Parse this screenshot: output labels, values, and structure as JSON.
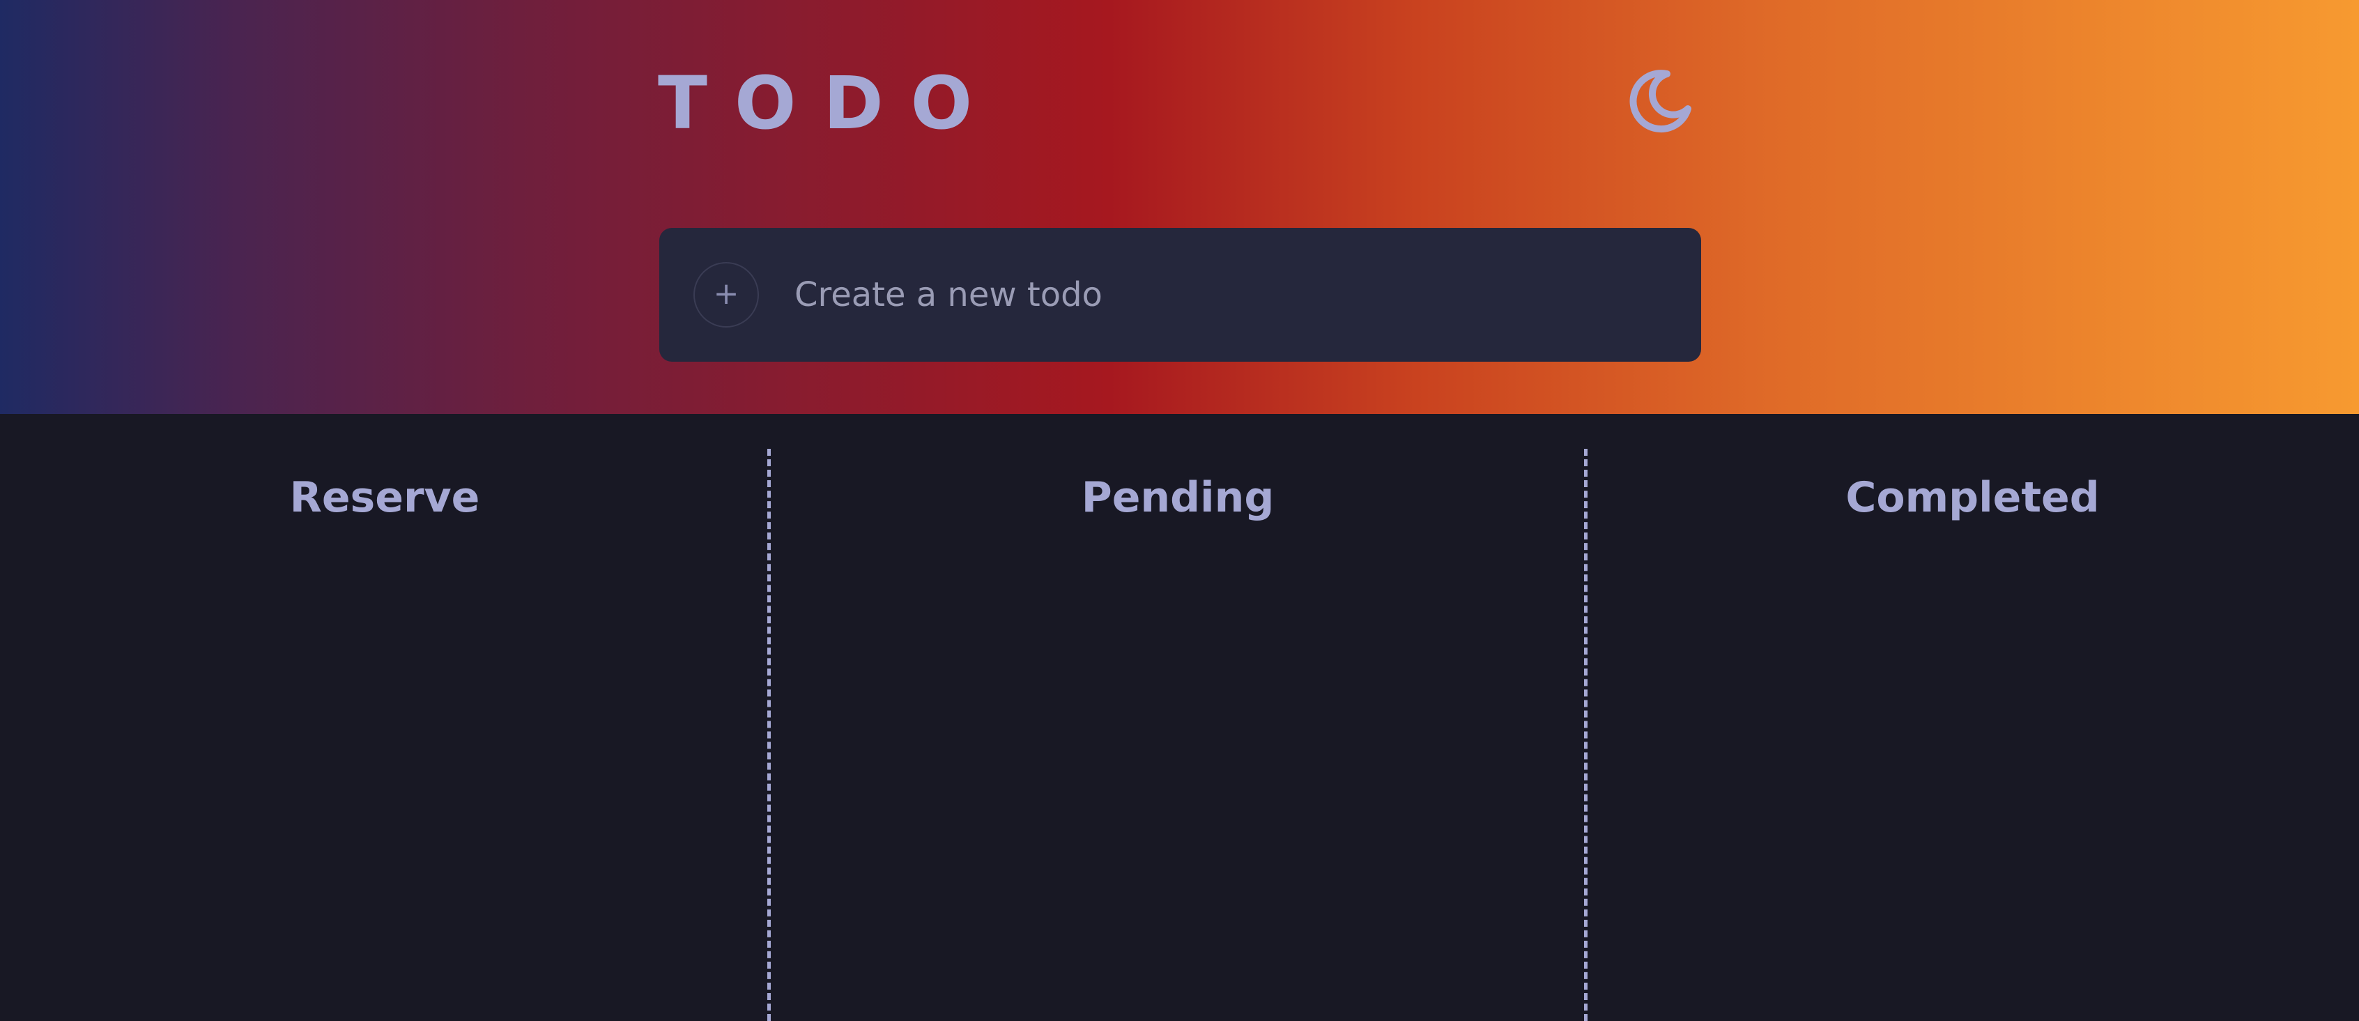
{
  "header": {
    "title": "TODO",
    "theme_toggle_icon": "moon-icon"
  },
  "new_todo": {
    "add_icon": "+",
    "placeholder": "Create a new todo",
    "value": ""
  },
  "board": {
    "columns": [
      {
        "title": "Reserve",
        "items": []
      },
      {
        "title": "Pending",
        "items": []
      },
      {
        "title": "Completed",
        "items": []
      }
    ]
  },
  "colors": {
    "gradient": [
      "#1f2a63",
      "#4a2450",
      "#a6181f",
      "#df6a28",
      "#f79a30"
    ],
    "background": "#181824",
    "input_background": "#25273c",
    "accent_text": "#a5a8d4"
  }
}
